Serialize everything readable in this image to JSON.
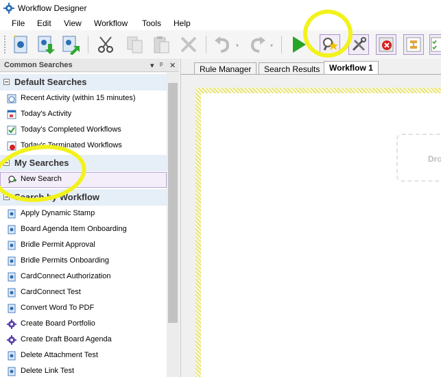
{
  "window": {
    "title": "Workflow Designer"
  },
  "menu": [
    "File",
    "Edit",
    "View",
    "Workflow",
    "Tools",
    "Help"
  ],
  "toolbar": {
    "buttons": [
      "new-workflow",
      "import-workflow",
      "export-workflow",
      "cut",
      "copy",
      "paste",
      "delete",
      "undo",
      "redo",
      "run",
      "search",
      "properties",
      "stop",
      "compare",
      "checklist"
    ]
  },
  "panel": {
    "title": "Common Searches",
    "pin_glyph": "▾",
    "autohide_glyph": "ᵖ",
    "close_glyph": "✕",
    "groups": {
      "default": {
        "label": "Default Searches",
        "items": [
          "Recent Activity (within 15 minutes)",
          "Today's Activity",
          "Today's Completed Workflows",
          "Today's Terminated Workflows"
        ]
      },
      "my": {
        "label": "My Searches",
        "items": [
          "New Search"
        ]
      },
      "workflow": {
        "label": "Search by Workflow",
        "items": [
          "Apply Dynamic Stamp",
          "Board Agenda Item Onboarding",
          "Bridle Permit Approval",
          "Bridle Permits Onboarding",
          "CardConnect Authorization",
          "CardConnect Test",
          "Convert Word To PDF",
          "Create Board Portfolio",
          "Create Draft Board Agenda",
          "Delete Attachment Test",
          "Delete Link Test"
        ]
      }
    }
  },
  "tabs": [
    "Rule Manager",
    "Search Results",
    "Workflow 1"
  ],
  "canvas": {
    "drop_hint": "Dro"
  },
  "colors": {
    "highlight": "#f2f21c",
    "selection": "#b9a6d6",
    "accent": "#4a7fc1"
  }
}
